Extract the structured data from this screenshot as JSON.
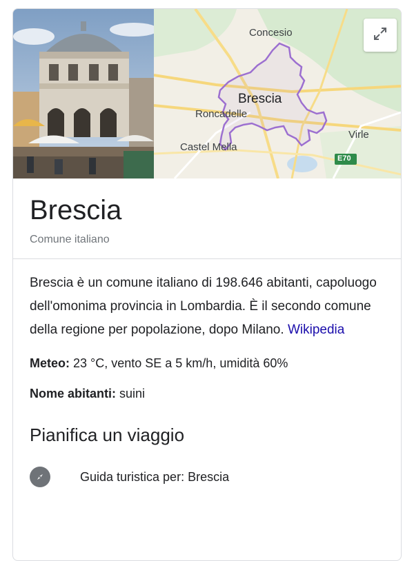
{
  "map": {
    "labels": {
      "concesio": "Concesio",
      "brescia": "Brescia",
      "roncadelle": "Roncadelle",
      "castel_mella": "Castel Mella",
      "virle": "Virle",
      "e70": "E70"
    },
    "boundary_color": "#9c6fd0"
  },
  "entity": {
    "title": "Brescia",
    "subtitle": "Comune italiano"
  },
  "description": {
    "text": "Brescia è un comune italiano di 198.646 abitanti, capoluogo dell'omonima provincia in Lombardia. È il secondo comune della regione per popolazione, dopo Milano.",
    "source_link": "Wikipedia"
  },
  "facts": {
    "weather_label": "Meteo:",
    "weather_value": "23 °C, vento SE a 5 km/h, umidità 60%",
    "demonym_label": "Nome abitanti:",
    "demonym_value": "suini"
  },
  "trip": {
    "title": "Pianifica un viaggio",
    "guide_label": "Guida turistica per: Brescia"
  },
  "icons": {
    "expand": "expand-icon",
    "compass": "compass-icon"
  }
}
